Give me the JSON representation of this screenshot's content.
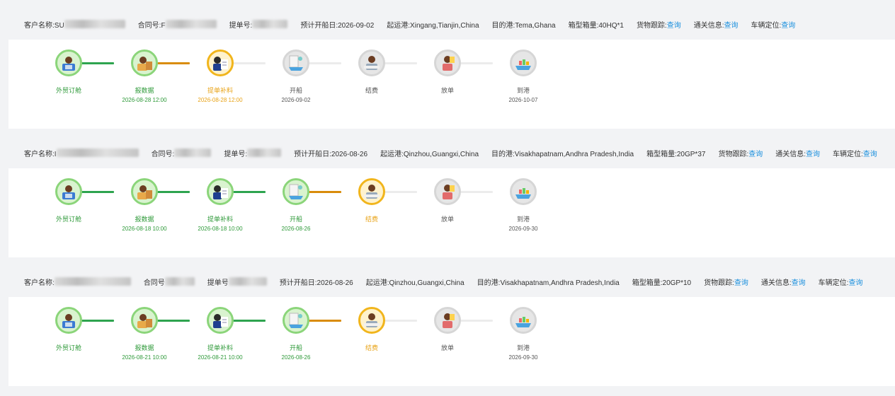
{
  "shipments": [
    {
      "customer_label": "客户名称:SU",
      "contract_label": "合同号:F",
      "bl_label": "提单号:",
      "etd": "预计开船日:2026-09-02",
      "origin": "起运港:Xingang,Tianjin,China",
      "destination": "目的港:Tema,Ghana",
      "container": "箱型箱量:40HQ*1",
      "cargo_track_label": "货物跟踪:",
      "cargo_track_link": "查询",
      "customs_label": "通关信息:",
      "customs_link": "查询",
      "vehicle_label": "车辆定位:",
      "vehicle_link": "查询",
      "steps": [
        {
          "label": "外贸订舱",
          "date": "",
          "state": "green",
          "icon": "booking-icon"
        },
        {
          "label": "报数据",
          "date": "2026-08-28 12:00",
          "state": "green",
          "icon": "data-report-icon"
        },
        {
          "label": "提单补料",
          "date": "2026-08-28 12:00",
          "state": "orange",
          "icon": "bill-of-lading-icon"
        },
        {
          "label": "开船",
          "date": "2026-09-02",
          "state": "gray",
          "icon": "sailing-icon"
        },
        {
          "label": "结费",
          "date": "",
          "state": "gray",
          "icon": "settlement-icon"
        },
        {
          "label": "放单",
          "date": "",
          "state": "gray",
          "icon": "release-icon"
        },
        {
          "label": "到港",
          "date": "2026-10-07",
          "state": "gray",
          "icon": "arrival-icon"
        }
      ],
      "connectors": [
        "green",
        "orange",
        "gray",
        "gray",
        "gray",
        "gray"
      ]
    },
    {
      "customer_label": "客户名称:I",
      "contract_label": "合同号:",
      "bl_label": "提单号:",
      "etd": "预计开船日:2026-08-26",
      "origin": "起运港:Qinzhou,Guangxi,China",
      "destination": "目的港:Visakhapatnam,Andhra Pradesh,India",
      "container": "箱型箱量:20GP*37",
      "cargo_track_label": "货物跟踪:",
      "cargo_track_link": "查询",
      "customs_label": "通关信息:",
      "customs_link": "查询",
      "vehicle_label": "车辆定位:",
      "vehicle_link": "查询",
      "steps": [
        {
          "label": "外贸订舱",
          "date": "",
          "state": "green",
          "icon": "booking-icon"
        },
        {
          "label": "报数据",
          "date": "2026-08-18 10:00",
          "state": "green",
          "icon": "data-report-icon"
        },
        {
          "label": "提单补料",
          "date": "2026-08-18 10:00",
          "state": "green",
          "icon": "bill-of-lading-icon"
        },
        {
          "label": "开船",
          "date": "2026-08-26",
          "state": "green",
          "icon": "sailing-icon"
        },
        {
          "label": "结费",
          "date": "",
          "state": "orange",
          "icon": "settlement-icon"
        },
        {
          "label": "放单",
          "date": "",
          "state": "gray",
          "icon": "release-icon"
        },
        {
          "label": "到港",
          "date": "2026-09-30",
          "state": "gray",
          "icon": "arrival-icon"
        }
      ],
      "connectors": [
        "green",
        "green",
        "green",
        "orange",
        "gray",
        "gray"
      ]
    },
    {
      "customer_label": "客户名称:",
      "contract_label": "合同号",
      "bl_label": "提单号",
      "etd": "预计开船日:2026-08-26",
      "origin": "起运港:Qinzhou,Guangxi,China",
      "destination": "目的港:Visakhapatnam,Andhra Pradesh,India",
      "container": "箱型箱量:20GP*10",
      "cargo_track_label": "货物跟踪:",
      "cargo_track_link": "查询",
      "customs_label": "通关信息:",
      "customs_link": "查询",
      "vehicle_label": "车辆定位:",
      "vehicle_link": "查询",
      "steps": [
        {
          "label": "外贸订舱",
          "date": "",
          "state": "green",
          "icon": "booking-icon"
        },
        {
          "label": "报数据",
          "date": "2026-08-21 10:00",
          "state": "green",
          "icon": "data-report-icon"
        },
        {
          "label": "提单补料",
          "date": "2026-08-21 10:00",
          "state": "green",
          "icon": "bill-of-lading-icon"
        },
        {
          "label": "开船",
          "date": "2026-08-26",
          "state": "green",
          "icon": "sailing-icon"
        },
        {
          "label": "结费",
          "date": "",
          "state": "orange",
          "icon": "settlement-icon"
        },
        {
          "label": "放单",
          "date": "",
          "state": "gray",
          "icon": "release-icon"
        },
        {
          "label": "到港",
          "date": "2026-09-30",
          "state": "gray",
          "icon": "arrival-icon"
        }
      ],
      "connectors": [
        "green",
        "green",
        "green",
        "orange",
        "gray",
        "gray"
      ]
    }
  ],
  "colors": {
    "done": "#2ea44f",
    "current": "#d98c0b",
    "pending": "#ececec",
    "link": "#1a8fdd"
  }
}
